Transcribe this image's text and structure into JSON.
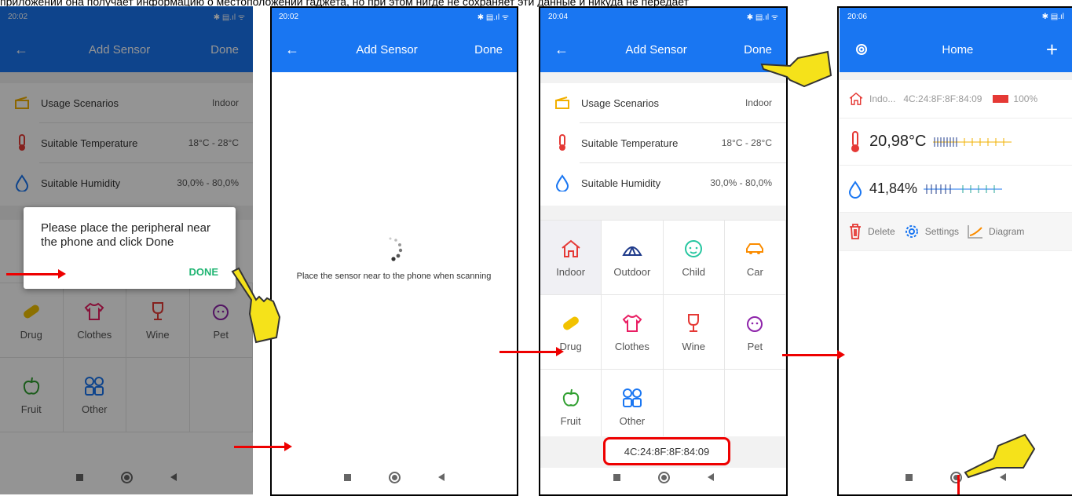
{
  "caption": "приложении она получает информацию о местоположении гаджета, но при этом нигде не сохраняет эти данные и никуда не передает",
  "screen1": {
    "status_time": "20:02",
    "status_right": "✱ ▤.ıl ᯤ",
    "back": "←",
    "title": "Add Sensor",
    "done": "Done",
    "rows": [
      {
        "label": "Usage Scenarios",
        "value": "Indoor"
      },
      {
        "label": "Suitable Temperature",
        "value": "18°C - 28°C"
      },
      {
        "label": "Suitable Humidity",
        "value": "30,0% - 80,0%"
      }
    ],
    "dialog_message": "Please place the peripheral near the phone and click Done",
    "dialog_button": "DONE",
    "grid": [
      "Drug",
      "Clothes",
      "Wine",
      "Pet",
      "Fruit",
      "Other"
    ]
  },
  "screen2": {
    "status_time": "20:02",
    "status_right": "✱ ▤.ıl ᯤ",
    "back": "←",
    "title": "Add Sensor",
    "done": "Done",
    "scanning_text": "Place the sensor near to the phone when scanning"
  },
  "screen3": {
    "status_time": "20:04",
    "status_right": "✱ ▤.ıl ᯤ",
    "back": "←",
    "title": "Add Sensor",
    "done": "Done",
    "rows": [
      {
        "label": "Usage Scenarios",
        "value": "Indoor"
      },
      {
        "label": "Suitable Temperature",
        "value": "18°C - 28°C"
      },
      {
        "label": "Suitable Humidity",
        "value": "30,0% - 80,0%"
      }
    ],
    "grid": [
      "Indoor",
      "Outdoor",
      "Child",
      "Car",
      "Drug",
      "Clothes",
      "Wine",
      "Pet",
      "Fruit",
      "Other"
    ],
    "mac": "4C:24:8F:8F:84:09"
  },
  "screen4": {
    "status_time": "20:06",
    "status_right": "✱ ▤.ıl",
    "title": "Home",
    "plus": "+",
    "sensor_name": "Indo...",
    "sensor_mac": "4C:24:8F:8F:84:09",
    "battery": "100%",
    "temperature": "20,98°C",
    "humidity": "41,84%",
    "actions": {
      "delete": "Delete",
      "settings": "Settings",
      "diagram": "Diagram"
    }
  },
  "colors": {
    "accent": "#1976f2",
    "arrow": "#e00000",
    "done_green": "#21b573"
  }
}
